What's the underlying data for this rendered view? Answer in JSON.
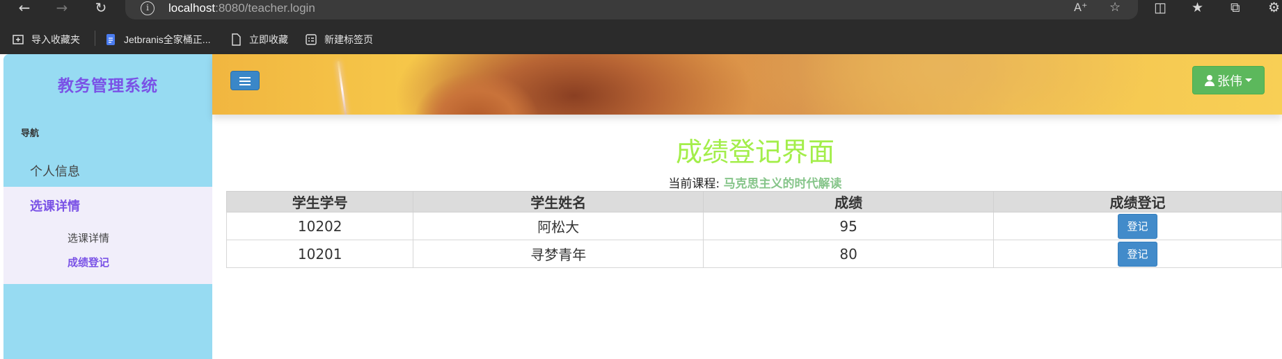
{
  "browser": {
    "url_host": "localhost",
    "url_rest": ":8080/teacher.login",
    "bookmarks": [
      {
        "label": "导入收藏夹"
      },
      {
        "label": "Jetbranis全家桶正..."
      },
      {
        "label": "立即收藏"
      },
      {
        "label": "新建标签页"
      }
    ]
  },
  "sidebar": {
    "brand": "教务管理系统",
    "nav_heading": "导航",
    "profile_label": "个人信息",
    "section_title": "选课详情",
    "sub_items": [
      {
        "label": "选课详情"
      },
      {
        "label": "成绩登记"
      }
    ]
  },
  "header": {
    "user_name": "张伟"
  },
  "main": {
    "title": "成绩登记界面",
    "course_prefix": "当前课程:",
    "course_name": "马克思主义的时代解读",
    "table": {
      "headers": [
        "学生学号",
        "学生姓名",
        "成绩",
        "成绩登记"
      ],
      "rows": [
        {
          "id": "10202",
          "name": "阿松大",
          "score": "95",
          "action": "登记"
        },
        {
          "id": "10201",
          "name": "寻梦青年",
          "score": "80",
          "action": "登记"
        }
      ]
    }
  },
  "colors": {
    "brand_purple": "#7a52e6",
    "title_green": "#a3ee4a",
    "course_green": "#86c58a",
    "sidebar_bg": "#97dbf2",
    "user_button": "#5cb85c",
    "primary_button": "#428bca"
  }
}
